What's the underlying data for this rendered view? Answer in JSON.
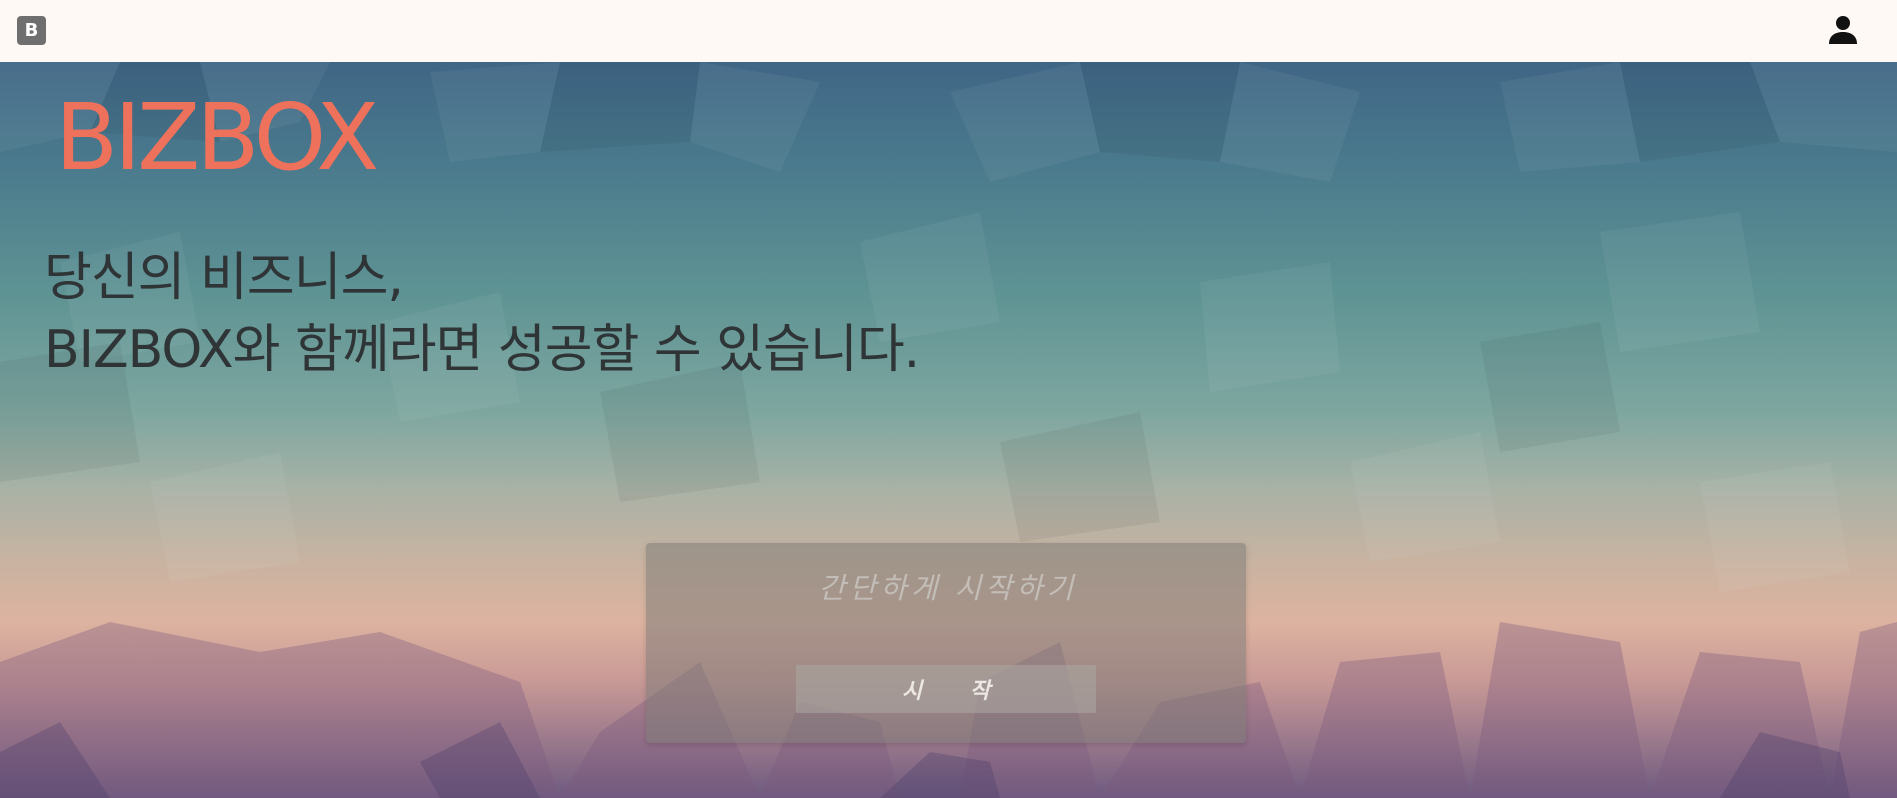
{
  "header": {
    "logo_letter": "B",
    "user_icon": "user-icon"
  },
  "hero": {
    "brand": "BIZBOX",
    "tagline_line1": "당신의 비즈니스,",
    "tagline_line2": "BIZBOX와 함께라면 성공할 수 있습니다.",
    "brand_color": "#ee715b"
  },
  "start_form": {
    "placeholder": "간단하게 시작하기",
    "value": "",
    "button_label": "시 작"
  }
}
